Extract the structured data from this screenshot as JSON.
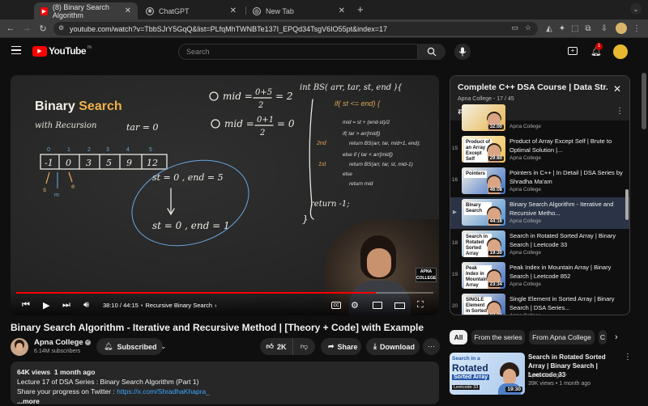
{
  "browser": {
    "tabs": [
      {
        "title": "(8) Binary Search Algorithm",
        "icon": "youtube-icon",
        "active": true
      },
      {
        "title": "ChatGPT",
        "icon": "chatgpt-icon",
        "active": false
      },
      {
        "title": "New Tab",
        "icon": "globe-icon",
        "active": false
      }
    ],
    "url": "youtube.com/watch?v=TbbSJrY5GqQ&list=PLfqMhTWNBTe137I_EPQd34TsgV6IO55pt&index=17"
  },
  "youtube": {
    "logo_text": "YouTube",
    "logo_badge": "IN",
    "search_placeholder": "Search",
    "notification_count": "1"
  },
  "video": {
    "board_title_1": "Binary",
    "board_title_2": "Search",
    "board_subtitle": "with Recursion",
    "time_current": "38:10",
    "time_total": "44:15",
    "time_separator": "/",
    "chapter": "Recursive Binary Search",
    "progress": 0.862,
    "watermark": "APNA COLLEGE"
  },
  "meta": {
    "title": "Binary Search Algorithm - Iterative and Recursive Method | [Theory + Code] with Example",
    "channel": "Apna College",
    "subscribers": "6.14M subscribers",
    "subscribed_label": "Subscribed",
    "likes": "2K",
    "share_label": "Share",
    "download_label": "Download"
  },
  "description": {
    "views": "64K views",
    "age": "1 month ago",
    "line1": "Lecture 17 of DSA Series : Binary Search Algorithm (Part 1)",
    "line2_prefix": "Share your progress on Twitter : ",
    "line2_link": "https://x.com/ShradhaKhapra_",
    "more": "...more"
  },
  "playlist": {
    "title": "Complete C++ DSA Course | Data Str...",
    "channel": "Apna College",
    "position": "17 / 45",
    "items": [
      {
        "index": "",
        "title": "",
        "channel": "Apna College",
        "duration": "32:00",
        "caption": "",
        "color": "#e6b54a"
      },
      {
        "index": "15",
        "title": "Product of Array Except Self | Brute to Optimal Solution |...",
        "channel": "Apna College",
        "duration": "29:80",
        "caption": "Product of an Array Except Self",
        "color": "#f0c24a"
      },
      {
        "index": "16",
        "title": "Pointers in C++ | In Detail | DSA Series by Shradha Ma'am",
        "channel": "Apna College",
        "duration": "46:08",
        "caption": "Pointers",
        "color": "#3b6ec9"
      },
      {
        "index": "▶",
        "title": "Binary Search Algorithm - Iterative and Recursive Metho...",
        "channel": "Apna College",
        "duration": "44:16",
        "caption": "Binary Search",
        "color": "#4a8fd6"
      },
      {
        "index": "18",
        "title": "Search in Rotated Sorted Array | Binary Search | Leetcode 33",
        "channel": "Apna College",
        "duration": "19:30",
        "caption": "Search in Rotated Sorted Array",
        "color": "#4a8fd6"
      },
      {
        "index": "19",
        "title": "Peak Index in Mountain Array | Binary Search | Leetcode 852",
        "channel": "Apna College",
        "duration": "23:34",
        "caption": "Peak Index in Mountain Array",
        "color": "#3b6ec9"
      },
      {
        "index": "20",
        "title": "Single Element in Sorted Array | Binary Search | DSA Series...",
        "channel": "Apna College",
        "duration": "27:33",
        "caption": "SINGLE Element in Sorted Array",
        "color": "#2f5fb8"
      }
    ]
  },
  "chips": [
    "All",
    "From the series",
    "From Apna College",
    "C"
  ],
  "recommended": {
    "title": "Search in Rotated Sorted Array | Binary Search | Leetcode 33",
    "channel": "Apna College",
    "views": "39K views",
    "age": "1 month ago",
    "duration": "19:30",
    "thumb_line1": "Search in a",
    "thumb_line2": "Rotated",
    "thumb_line3": "Sorted Array",
    "thumb_line4": "Leetcode 33"
  }
}
